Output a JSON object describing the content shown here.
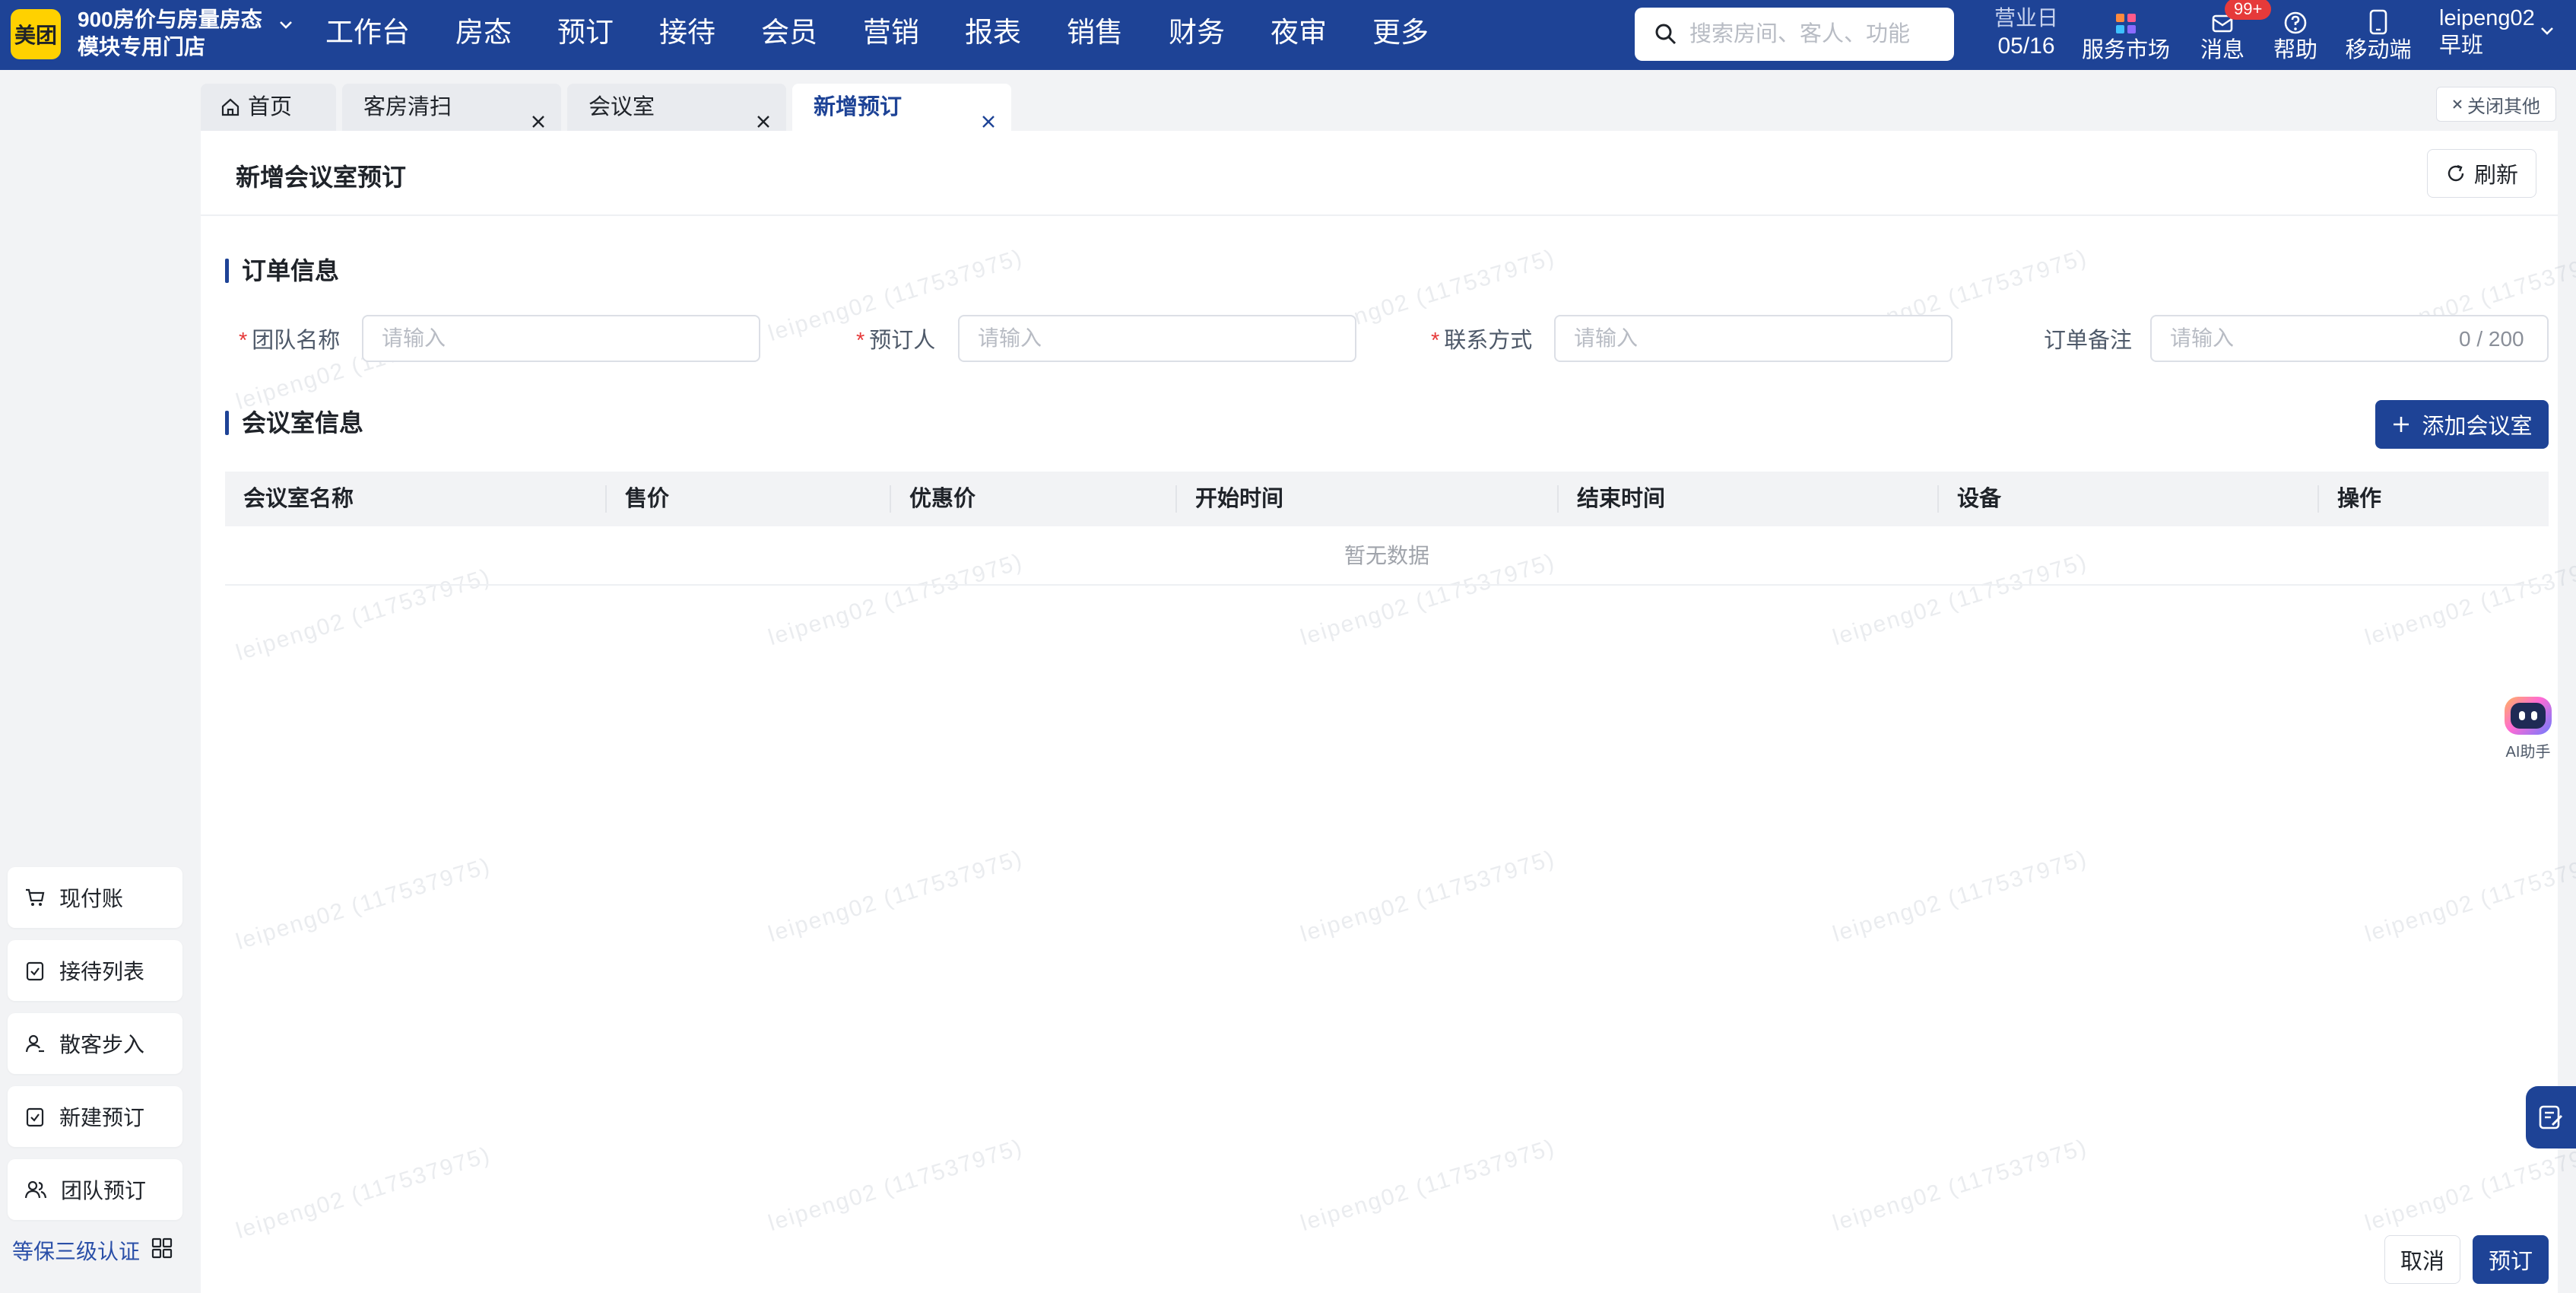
{
  "header": {
    "logo": "美团",
    "store_line1": "900房价与房量房态",
    "store_line2": "模块专用门店",
    "nav": [
      "工作台",
      "房态",
      "预订",
      "接待",
      "会员",
      "营销",
      "报表",
      "销售",
      "财务",
      "夜审",
      "更多"
    ],
    "search_placeholder": "搜索房间、客人、功能",
    "business_day_label": "营业日",
    "business_day": "05/16",
    "tools": {
      "service_market": "服务市场",
      "messages": "消息",
      "messages_badge": "99+",
      "help": "帮助",
      "mobile": "移动端"
    },
    "user_name": "leipeng02",
    "shift": "早班",
    "brand_color": "#1e4396"
  },
  "sidebar": {
    "quick_actions": [
      "现付账",
      "接待列表",
      "散客步入",
      "新建预订",
      "团队预订"
    ],
    "certification": "等保三级认证"
  },
  "tabs": {
    "items": [
      "首页",
      "客房清扫",
      "会议室",
      "新增预订"
    ],
    "active_index": 3,
    "close_others": "关闭其他"
  },
  "page": {
    "title": "新增会议室预订",
    "refresh": "刷新"
  },
  "order_info": {
    "title": "订单信息",
    "fields": {
      "team_name": {
        "label": "团队名称",
        "placeholder": "请输入"
      },
      "booker": {
        "label": "预订人",
        "placeholder": "请输入"
      },
      "contact": {
        "label": "联系方式",
        "placeholder": "请输入"
      },
      "remark": {
        "label": "订单备注",
        "placeholder": "请输入",
        "counter": "0 / 200"
      }
    }
  },
  "meeting_info": {
    "title": "会议室信息",
    "add_button": "添加会议室",
    "columns": [
      "会议室名称",
      "售价",
      "优惠价",
      "开始时间",
      "结束时间",
      "设备",
      "操作"
    ],
    "empty_text": "暂无数据"
  },
  "watermark": "leipeng02 (117537975)",
  "ai_helper": "AI助手",
  "footer": {
    "cancel": "取消",
    "book": "预订"
  }
}
